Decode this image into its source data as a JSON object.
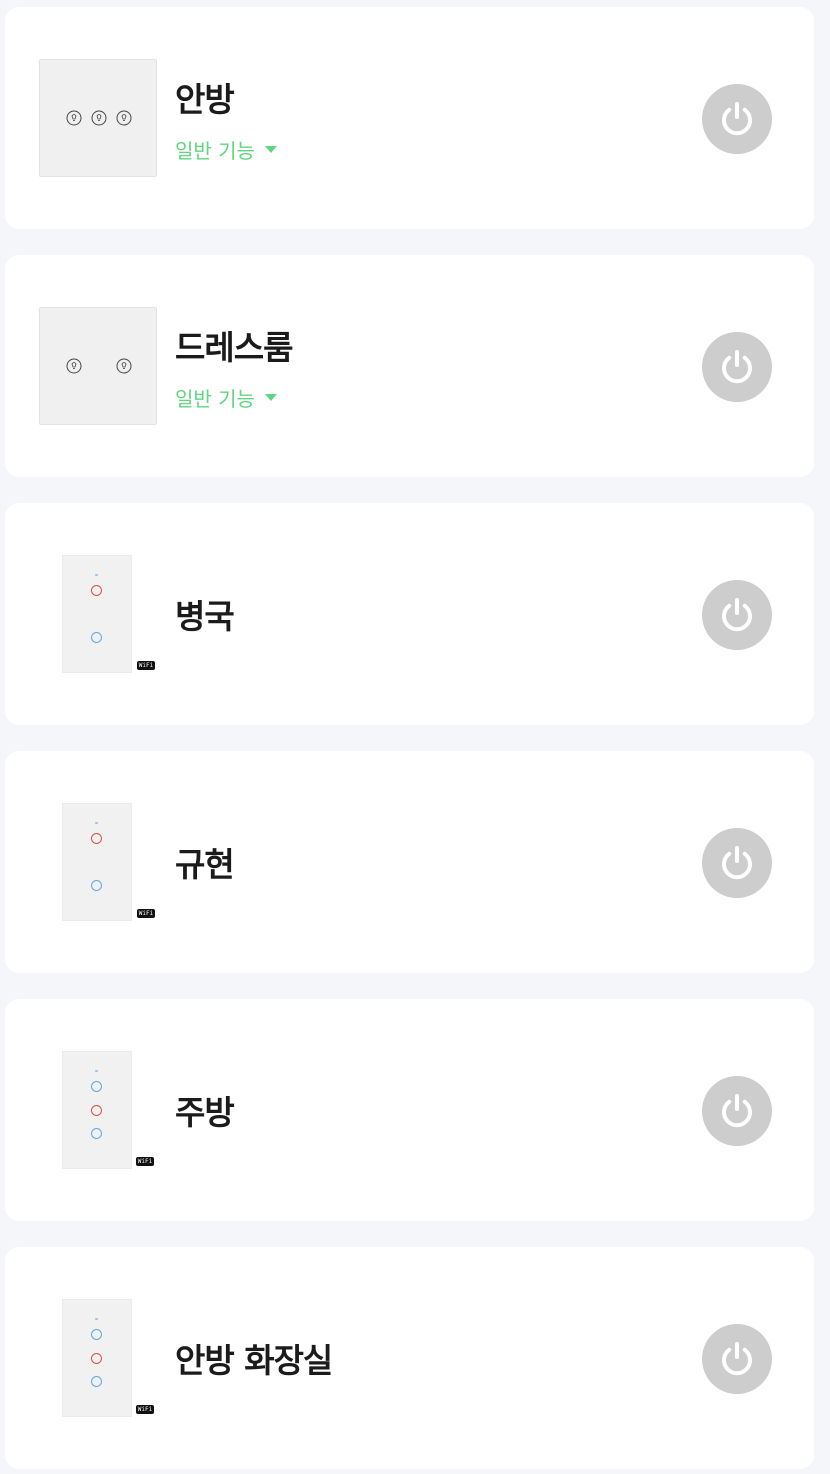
{
  "devices": [
    {
      "name": "안방",
      "subtitle": "일반 기능",
      "icon": "three-gang-bulb-switch"
    },
    {
      "name": "드레스룸",
      "subtitle": "일반 기능",
      "icon": "two-gang-bulb-switch"
    },
    {
      "name": "병국",
      "icon": "two-gang-touch-switch",
      "badge": "WiFi"
    },
    {
      "name": "규현",
      "icon": "two-gang-touch-switch",
      "badge": "WiFi"
    },
    {
      "name": "주방",
      "icon": "three-gang-touch-switch",
      "badge": "WiFi"
    },
    {
      "name": "안방 화장실",
      "icon": "three-gang-touch-switch",
      "badge": "WiFi"
    }
  ],
  "colors": {
    "background": "#f5f6fa",
    "card": "#ffffff",
    "subtitle": "#5fd67f",
    "power_button": "#cdcdcd",
    "touch_on": "#ea4a4a",
    "touch_off": "#5aa7ee"
  }
}
